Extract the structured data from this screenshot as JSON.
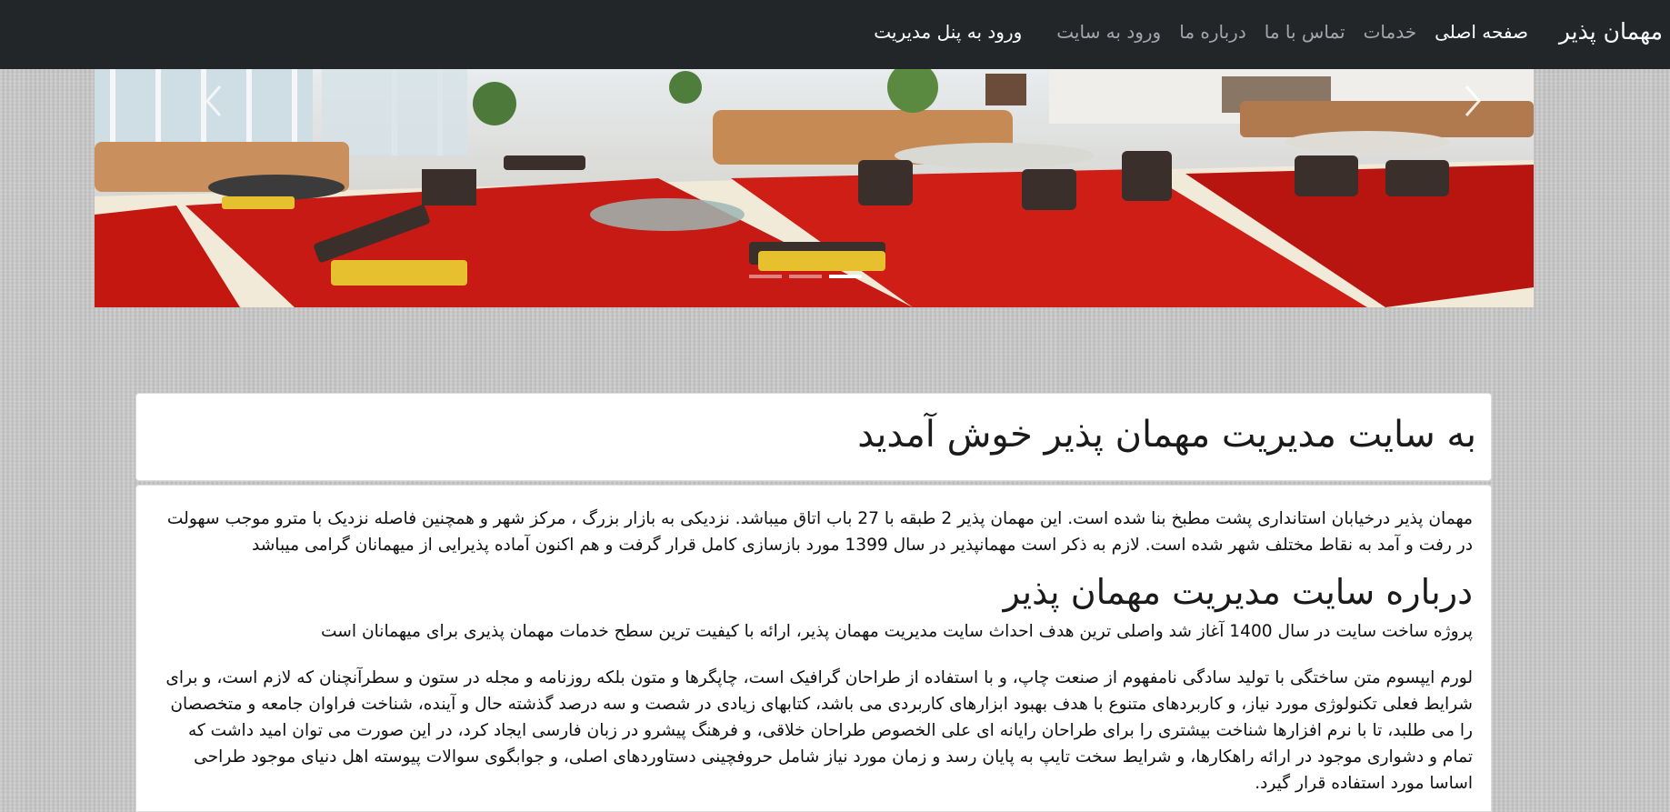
{
  "nav": {
    "brand": "مهمان پذیر",
    "links": [
      {
        "label": "صفحه اصلی",
        "active": true
      },
      {
        "label": "خدمات"
      },
      {
        "label": "تماس با ما"
      },
      {
        "label": "درباره ما"
      },
      {
        "label": "ورود به سایت"
      },
      {
        "label": "ورود به پنل مدیریت"
      }
    ]
  },
  "carousel": {
    "indicator_count": 3,
    "active_indicator": 3,
    "prev_icon": "chevron-left-icon",
    "next_icon": "chevron-right-icon"
  },
  "content": {
    "welcome_title": "به سایت مدیریت مهمان پذیر خوش آمدید",
    "intro": "مهمان پذیر درخیابان استانداری پشت مطبخ بنا شده است. این مهمان پذیر 2 طبقه با 27 باب اتاق میباشد. نزدیکی به بازار بزرگ ، مرکز شهر و همچنین فاصله نزدیک با مترو موجب سهولت در رفت و آمد به نقاط مختلف شهر شده است. لازم به ذکر است مهمانپذیر در سال 1399 مورد بازسازی کامل قرار گرفت و هم اکنون آماده پذیرایی از میهمانان گرامی میباشد",
    "about_title": "درباره سایت مدیریت مهمان پذیر",
    "about_text": "پروژه ساخت سایت در سال 1400 آغاز شد واصلی ترین هدف احداث سایت مدیریت مهمان پذیر، ارائه با کیفیت ترین سطح خدمات مهمان پذیری برای میهمانان است",
    "lorem": "لورم ایپسوم متن ساختگی با تولید سادگی نامفهوم از صنعت چاپ، و با استفاده از طراحان گرافیک است، چاپگرها و متون بلکه روزنامه و مجله در ستون و سطرآنچنان که لازم است، و برای شرایط فعلی تکنولوژی مورد نیاز، و کاربردهای متنوع با هدف بهبود ابزارهای کاربردی می باشد، کتابهای زیادی در شصت و سه درصد گذشته حال و آینده، شناخت فراوان جامعه و متخصصان را می طلبد، تا با نرم افزارها شناخت بیشتری را برای طراحان رایانه ای علی الخصوص طراحان خلاقی، و فرهنگ پیشرو در زبان فارسی ایجاد کرد، در این صورت می توان امید داشت که تمام و دشواری موجود در ارائه راهکارها، و شرایط سخت تایپ به پایان رسد و زمان مورد نیاز شامل حروفچینی دستاوردهای اصلی، و جوابگوی سوالات پیوسته اهل دنیای موجود طراحی اساسا مورد استفاده قرار گیرد."
  },
  "colors": {
    "navbar": "#222629",
    "nav_link": "#a3a7ab",
    "nav_active": "#ffffff",
    "card_bg": "#ffffff"
  }
}
